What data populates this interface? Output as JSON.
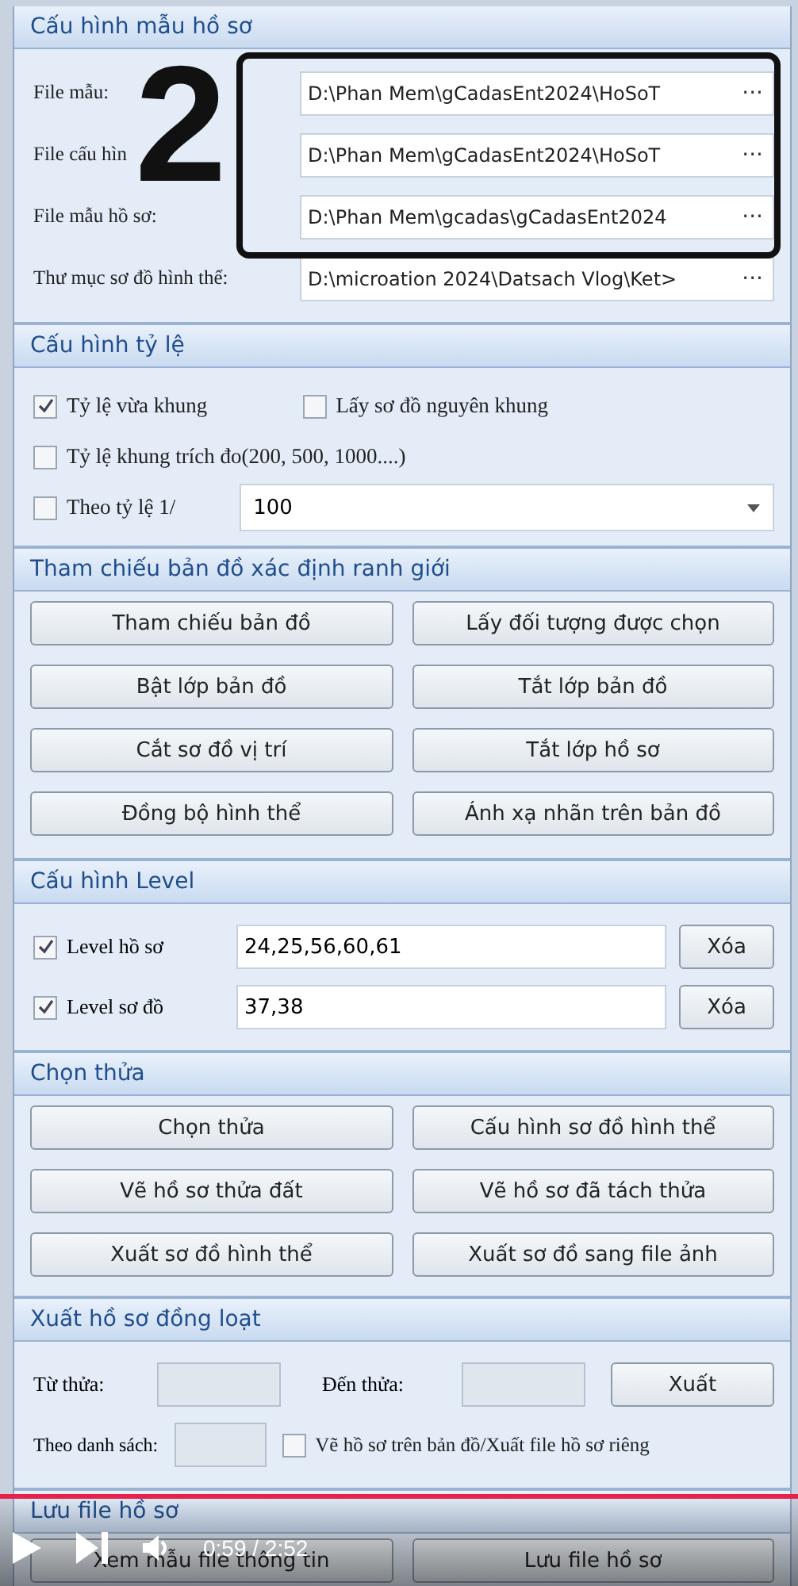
{
  "sections": [
    {
      "kind": "paths",
      "title": "Cấu hình mẫu hồ sơ",
      "rows": [
        {
          "label": "File mẫu:",
          "value": "D:\\Phan Mem\\gCadasEnt2024\\HoSoT",
          "button": "···"
        },
        {
          "label": "File cấu hìn",
          "value": "D:\\Phan Mem\\gCadasEnt2024\\HoSoT",
          "button": "···"
        },
        {
          "label": "File mẫu hồ sơ:",
          "value": "D:\\Phan Mem\\gcadas\\gCadasEnt2024",
          "button": "···"
        },
        {
          "label": "Thư mục sơ đồ hình thể:",
          "value": "D:\\microation 2024\\Datsach Vlog\\Ket>",
          "button": "···"
        }
      ]
    },
    {
      "kind": "scale",
      "title": "Cấu hình tỷ lệ",
      "checks": [
        {
          "label": "Tỷ lệ vừa khung",
          "checked": true
        },
        {
          "label": "Lấy sơ đồ nguyên khung",
          "checked": false
        },
        {
          "label": "Tỷ lệ khung trích đo(200, 500, 1000....)",
          "checked": false
        },
        {
          "label": "Theo tỷ lệ 1/",
          "checked": false
        }
      ],
      "combo": {
        "value": "100"
      }
    },
    {
      "kind": "buttons",
      "title": "Tham chiếu bản đồ xác định ranh giới",
      "buttons": [
        "Tham chiếu bản đồ",
        "Lấy đối tượng được chọn",
        "Bật lớp bản đồ",
        "Tắt lớp bản đồ",
        "Cắt sơ đồ vị trí",
        "Tắt lớp hồ sơ",
        "Đồng bộ hình thể",
        "Ánh xạ nhãn trên bản đồ"
      ]
    },
    {
      "kind": "levels",
      "title": "Cấu hình Level",
      "rows": [
        {
          "label": "Level hồ sơ",
          "checked": true,
          "value": "24,25,56,60,61",
          "button": "Xóa"
        },
        {
          "label": "Level sơ đồ",
          "checked": true,
          "value": "37,38",
          "button": "Xóa"
        }
      ]
    },
    {
      "kind": "buttons",
      "title": "Chọn thửa",
      "buttons": [
        "Chọn thửa",
        "Cấu hình sơ đồ hình thể",
        "Vẽ hồ sơ thửa đất",
        "Vẽ hồ sơ đã tách thửa",
        "Xuất sơ đồ hình thể",
        "Xuất sơ đồ sang file ảnh"
      ]
    },
    {
      "kind": "batch",
      "title": "Xuất hồ sơ đồng loạt",
      "from_label": "Từ thửa:",
      "to_label": "Đến thửa:",
      "button": "Xuất",
      "list_label": "Theo danh sách:",
      "check": {
        "label": "Vẽ hồ sơ trên bản đồ/Xuất file hồ sơ riêng",
        "checked": false
      }
    },
    {
      "kind": "buttons",
      "title": "Lưu file hồ sơ",
      "buttons": [
        "Xem mẫu file thông tin",
        "Lưu file hồ sơ"
      ]
    }
  ],
  "annotation": {
    "number": "2"
  },
  "player": {
    "level": 1,
    "time": "0:59 / 2:52"
  }
}
